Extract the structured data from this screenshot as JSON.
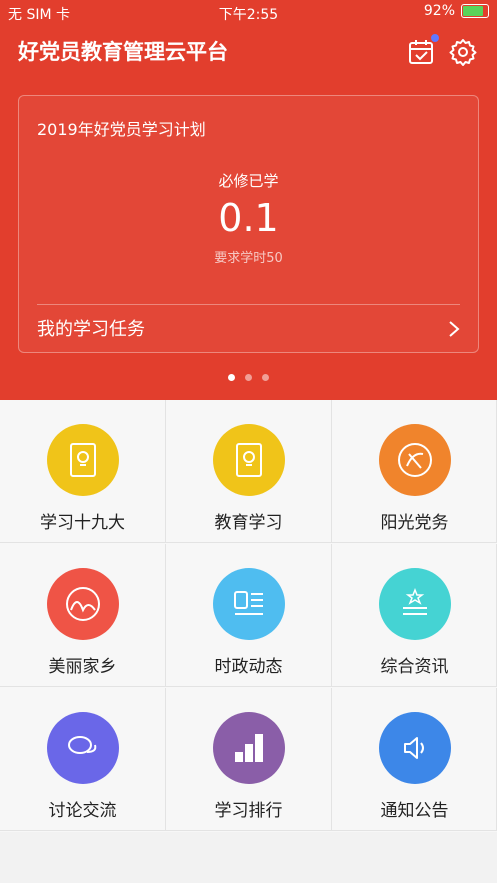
{
  "status_bar": {
    "carrier": "无 SIM 卡",
    "time": "下午2:55",
    "battery": "92%",
    "battery_level": 0.92
  },
  "header": {
    "title": "好党员教育管理云平台"
  },
  "card": {
    "title": "2019年好党员学习计划",
    "label": "必修已学",
    "value": "0.1",
    "requirement": "要求学时50",
    "task_link": "我的学习任务"
  },
  "pager": {
    "pages": 3,
    "active": 1
  },
  "grid": [
    {
      "label": "学习十九大",
      "icon": "book-lightbulb-icon",
      "color": "#f0c419"
    },
    {
      "label": "教育学习",
      "icon": "book-lightbulb-icon",
      "color": "#f0c419"
    },
    {
      "label": "阳光党务",
      "icon": "party-emblem-icon",
      "color": "#f0842c"
    },
    {
      "label": "美丽家乡",
      "icon": "landscape-icon",
      "color": "#ef5446"
    },
    {
      "label": "时政动态",
      "icon": "news-icon",
      "color": "#4fbdf0"
    },
    {
      "label": "综合资讯",
      "icon": "star-list-icon",
      "color": "#45d3d3"
    },
    {
      "label": "讨论交流",
      "icon": "chat-bubbles-icon",
      "color": "#6a67e8"
    },
    {
      "label": "学习排行",
      "icon": "ranking-blocks-icon",
      "color": "#8a5ea8"
    },
    {
      "label": "通知公告",
      "icon": "speaker-icon",
      "color": "#3d87e8"
    }
  ]
}
